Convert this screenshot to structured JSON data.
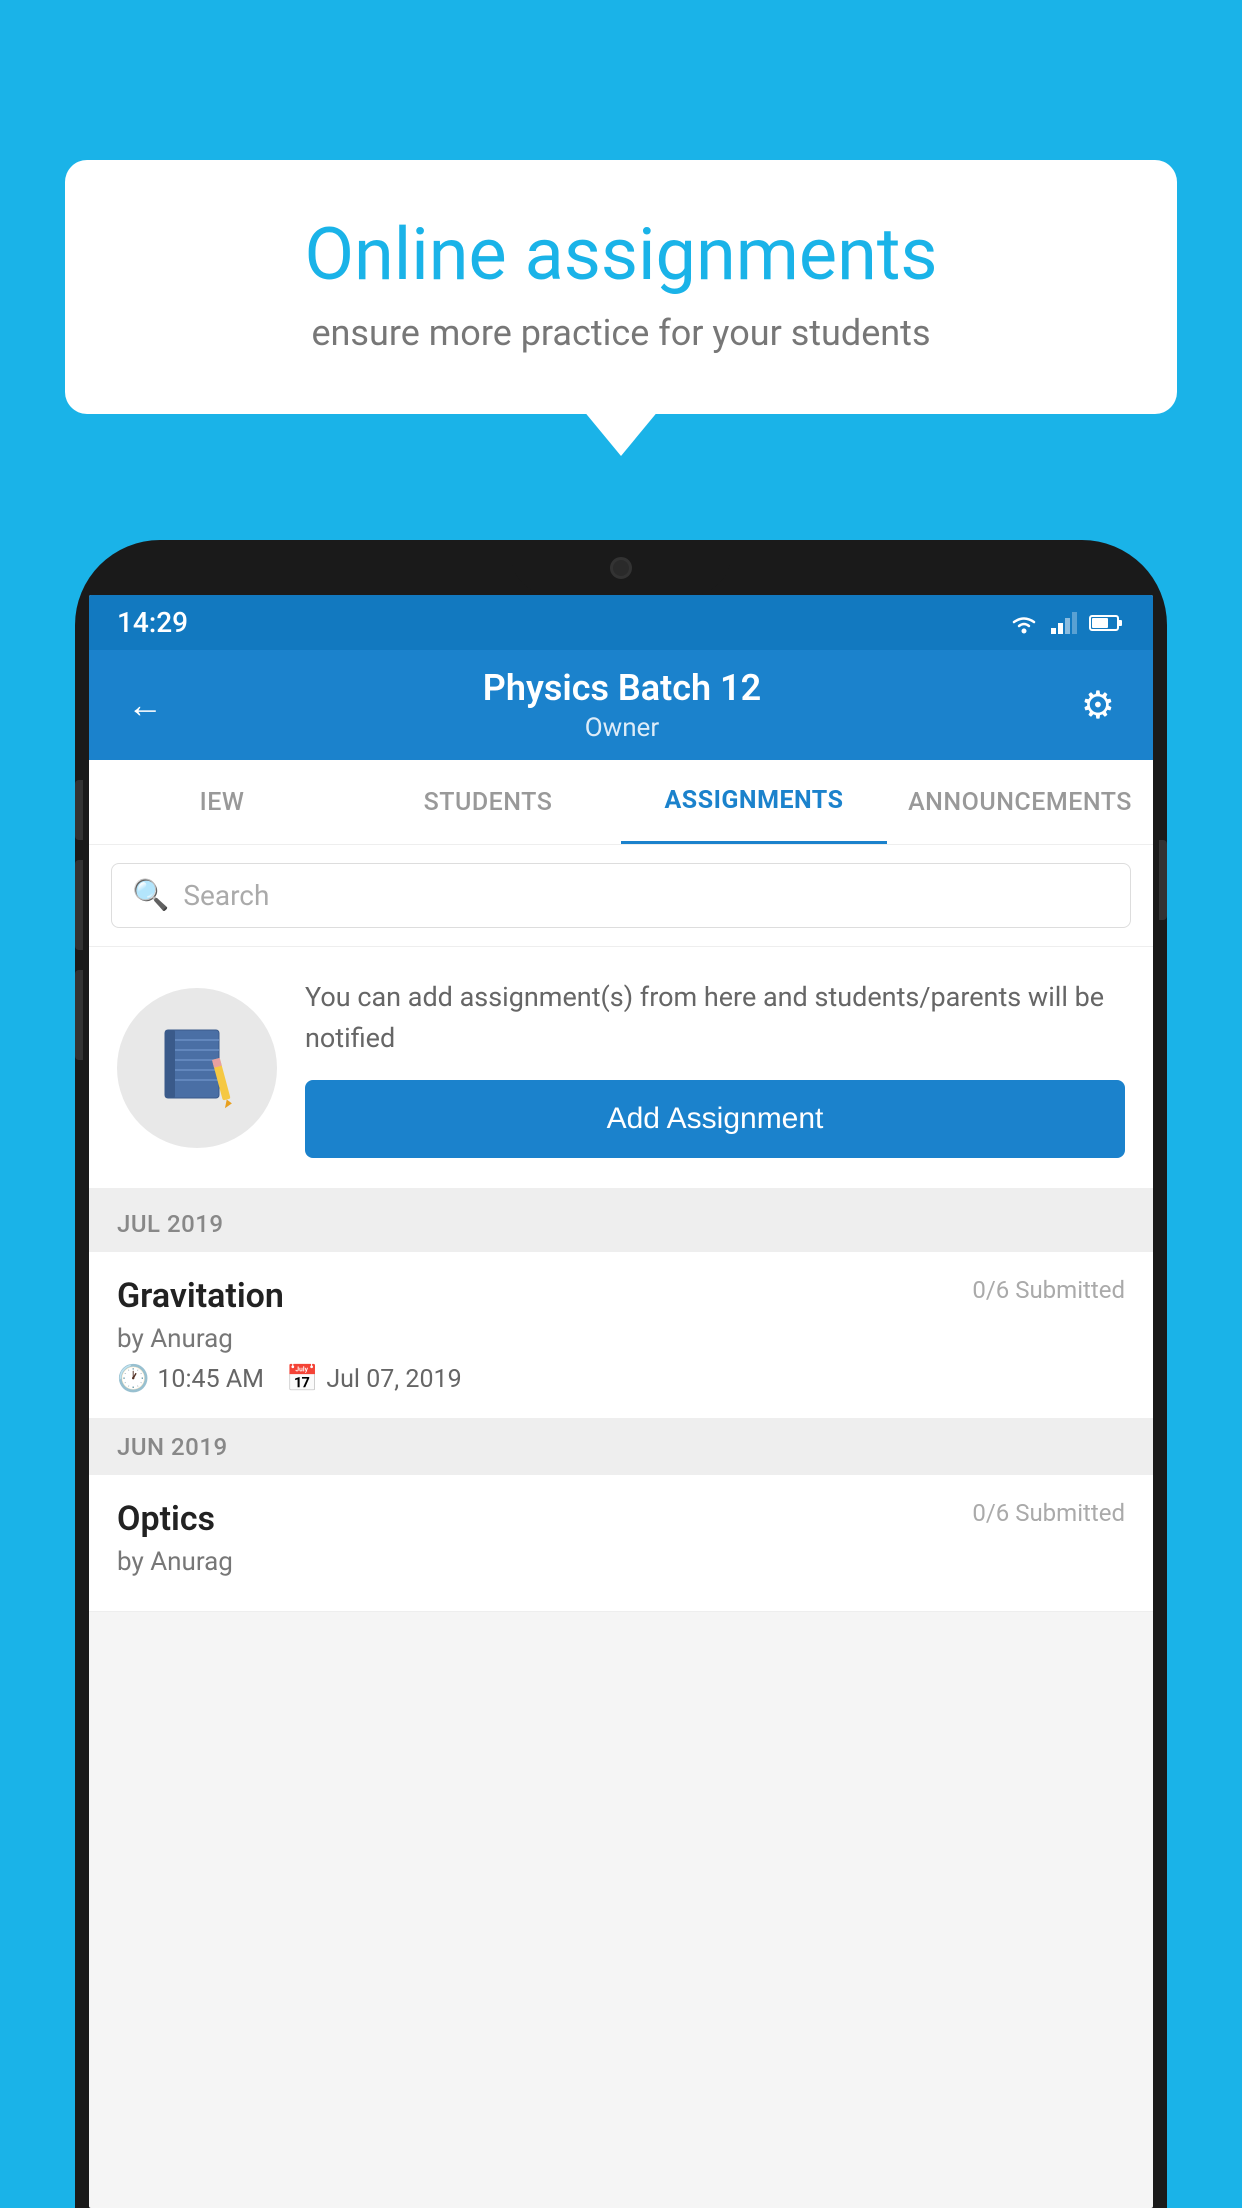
{
  "background_color": "#1ab3e8",
  "speech_bubble": {
    "title": "Online assignments",
    "subtitle": "ensure more practice for your students"
  },
  "status_bar": {
    "time": "14:29"
  },
  "app_header": {
    "title": "Physics Batch 12",
    "subtitle": "Owner"
  },
  "tabs": [
    {
      "label": "IEW",
      "active": false
    },
    {
      "label": "STUDENTS",
      "active": false
    },
    {
      "label": "ASSIGNMENTS",
      "active": true
    },
    {
      "label": "ANNOUNCEMENTS",
      "active": false
    }
  ],
  "search": {
    "placeholder": "Search"
  },
  "promo": {
    "description": "You can add assignment(s) from here and students/parents will be notified",
    "button_label": "Add Assignment"
  },
  "months": [
    {
      "label": "JUL 2019",
      "assignments": [
        {
          "name": "Gravitation",
          "submitted": "0/6 Submitted",
          "author": "by Anurag",
          "time": "10:45 AM",
          "date": "Jul 07, 2019"
        }
      ]
    },
    {
      "label": "JUN 2019",
      "assignments": [
        {
          "name": "Optics",
          "submitted": "0/6 Submitted",
          "author": "by Anurag",
          "time": "",
          "date": ""
        }
      ]
    }
  ]
}
